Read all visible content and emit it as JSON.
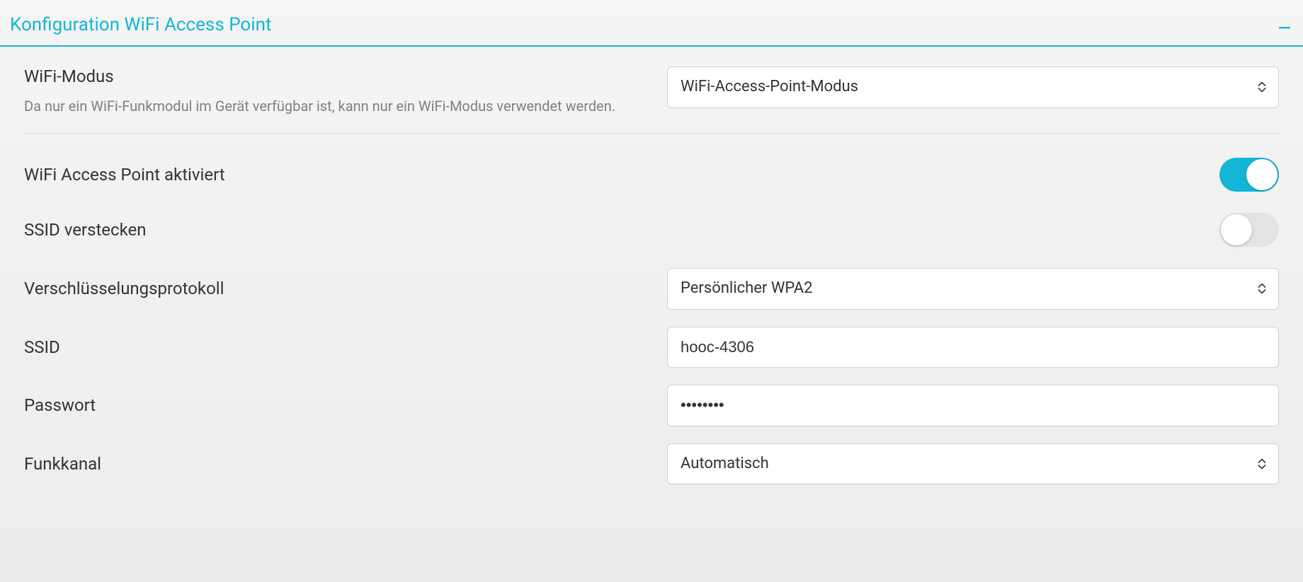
{
  "section": {
    "title": "Konfiguration WiFi Access Point"
  },
  "fields": {
    "wifi_mode": {
      "label": "WiFi-Modus",
      "desc": "Da nur ein WiFi-Funkmodul im Gerät verfügbar ist, kann nur ein WiFi-Modus verwendet werden.",
      "value": "WiFi-Access-Point-Modus"
    },
    "ap_enabled": {
      "label": "WiFi Access Point aktiviert",
      "value": true
    },
    "hide_ssid": {
      "label": "SSID verstecken",
      "value": false
    },
    "encryption": {
      "label": "Verschlüsselungsprotokoll",
      "value": "Persönlicher WPA2"
    },
    "ssid": {
      "label": "SSID",
      "value": "hooc-4306"
    },
    "password": {
      "label": "Passwort",
      "value": "••••••••"
    },
    "channel": {
      "label": "Funkkanal",
      "value": "Automatisch"
    }
  }
}
